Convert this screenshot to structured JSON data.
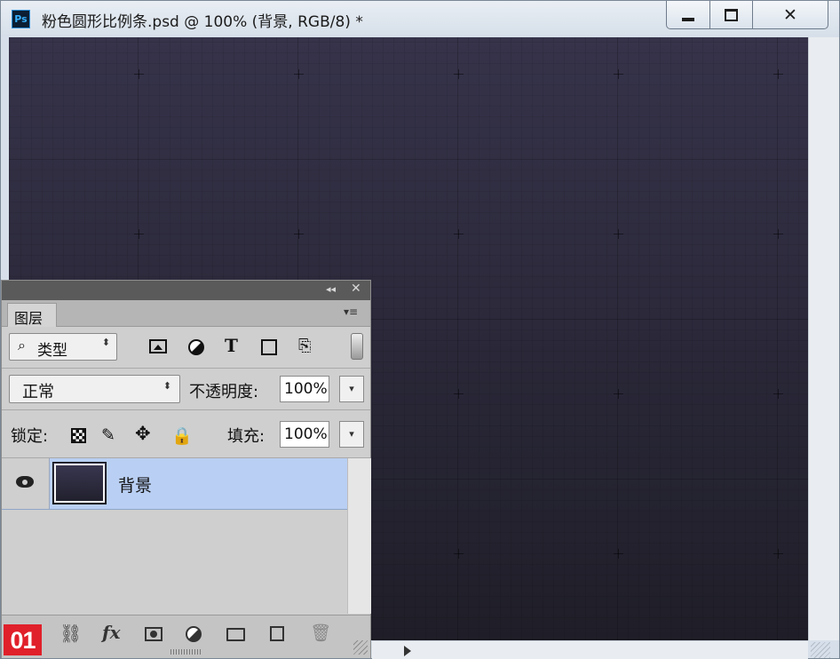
{
  "window": {
    "app_icon": "Ps",
    "title": "粉色圆形比例条.psd @ 100% (背景, RGB/8) *",
    "minimize_icon": "minimize-icon",
    "maximize_icon": "maximize-icon",
    "close_glyph": "✕"
  },
  "canvas": {
    "background_top": "#36334a",
    "background_bottom": "#1f1e28"
  },
  "layers_panel": {
    "collapse_glyph": "◂◂",
    "close_glyph": "✕",
    "tab_label": "图层",
    "menu_glyph": "▾≡",
    "filter": {
      "search_glyph": "⌕",
      "kind_label": "类型",
      "updown_glyph": "⬍"
    },
    "filter_icons": {
      "type_glyph": "T",
      "smart_glyph": "⎘"
    },
    "blend_mode": "正常",
    "blend_updown_glyph": "⬍",
    "opacity_label": "不透明度:",
    "opacity_value": "100%",
    "lock_label": "锁定:",
    "lock_icons": {
      "paint_glyph": "✎",
      "move_glyph": "✥",
      "all_glyph": "🔒"
    },
    "fill_label": "填充:",
    "fill_value": "100%",
    "dropdown_glyph": "▾",
    "layers": [
      {
        "name": "背景",
        "visible": true,
        "selected": true
      }
    ],
    "footer": {
      "badge": "01",
      "link_glyph": "⛓",
      "fx_label": "fx",
      "trash_glyph": "🗑"
    }
  }
}
